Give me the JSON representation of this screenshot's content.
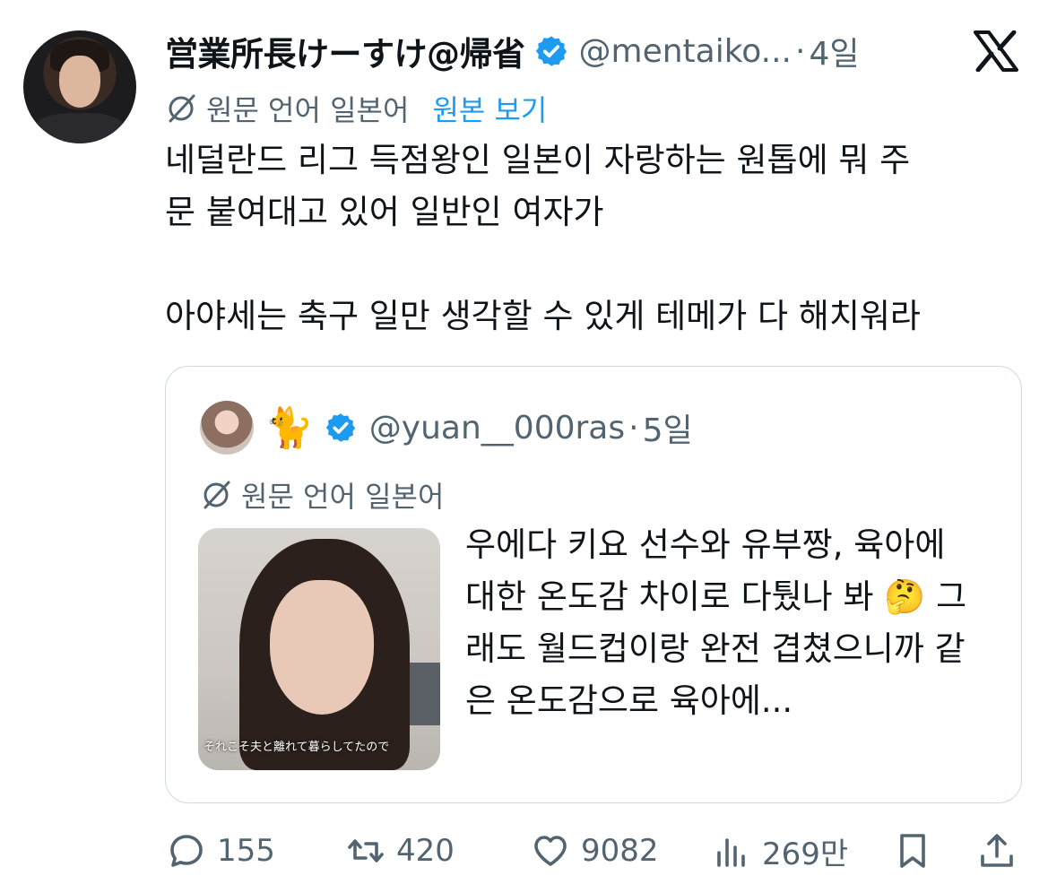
{
  "author": {
    "display_name": "営業所長けーすけ@帰省",
    "handle": "@mentaiko...",
    "time": "4일"
  },
  "translation": {
    "label": "원문 언어 일본어",
    "show_original": "원본 보기"
  },
  "body": "네덜란드 리그 득점왕인 일본이 자랑하는 원톱에 뭐 주\n문 붙여대고 있어 일반인 여자가\n\n아야세는 축구 일만 생각할 수 있게 테메가 다 해치워라",
  "quote": {
    "emoji": "🐈",
    "handle": "@yuan__000ras",
    "time": "5일",
    "translation_label": "원문 언어 일본어",
    "image_caption": "それこそ夫と離れて暮らしてたので",
    "text": "우에다 키요 선수와 유부짱, 육아에 대한 온도감 차이로 다퉜나 봐 🤔 그래도 월드컵이랑 완전 겹쳤으니까 같은 온도감으로 육아에..."
  },
  "actions": {
    "replies": "155",
    "reposts": "420",
    "likes": "9082",
    "views": "269만"
  },
  "colors": {
    "accent": "#1d9bf0",
    "muted": "#536471",
    "text": "#0f1419",
    "border": "#cfd9de"
  },
  "icons": [
    "verified-badge-icon",
    "x-logo-icon",
    "globe-slash-icon",
    "reply-icon",
    "repost-icon",
    "like-icon",
    "views-icon",
    "bookmark-icon",
    "share-icon"
  ]
}
